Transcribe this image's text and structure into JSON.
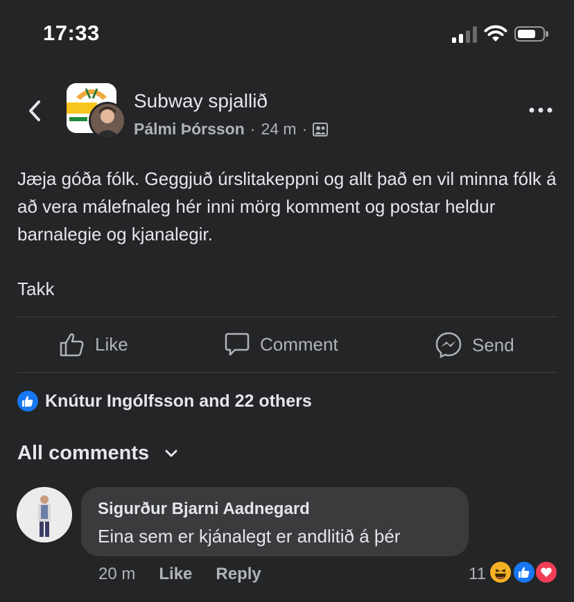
{
  "status_bar": {
    "time": "17:33"
  },
  "header": {
    "group_name": "Subway spjallið",
    "author": "Pálmi Þórsson",
    "time_ago": "24 m",
    "separator": "·",
    "privacy_icon": "group-members-icon"
  },
  "post": {
    "body": "Jæja góða fólk. Geggjuð úrslitakeppni og allt það en vil minna fólk á að vera málefnaleg hér inni mörg komment og postar heldur barnalegie og kjanalegir.",
    "closing": "Takk"
  },
  "actions": {
    "like": "Like",
    "comment": "Comment",
    "send": "Send"
  },
  "reactions": {
    "summary": "Knútur Ingólfsson and 22 others",
    "icon": "thumbs-up-icon"
  },
  "comments_section": {
    "filter_label": "All comments",
    "comments": [
      {
        "author": "Sigurður Bjarni Aadnegard",
        "text": "Eina sem er kjánalegt er andlitið á þér",
        "time": "20 m",
        "like_label": "Like",
        "reply_label": "Reply",
        "reaction_count": "11",
        "reaction_icons": [
          "laugh-icon",
          "like-icon",
          "love-icon"
        ]
      }
    ]
  },
  "colors": {
    "background": "#242526",
    "bubble": "#3a3b3c",
    "primary_text": "#e4e6eb",
    "secondary_text": "#b0b3b8",
    "accent": "#1877f2",
    "love": "#f33e58",
    "haha": "#f7b125"
  }
}
